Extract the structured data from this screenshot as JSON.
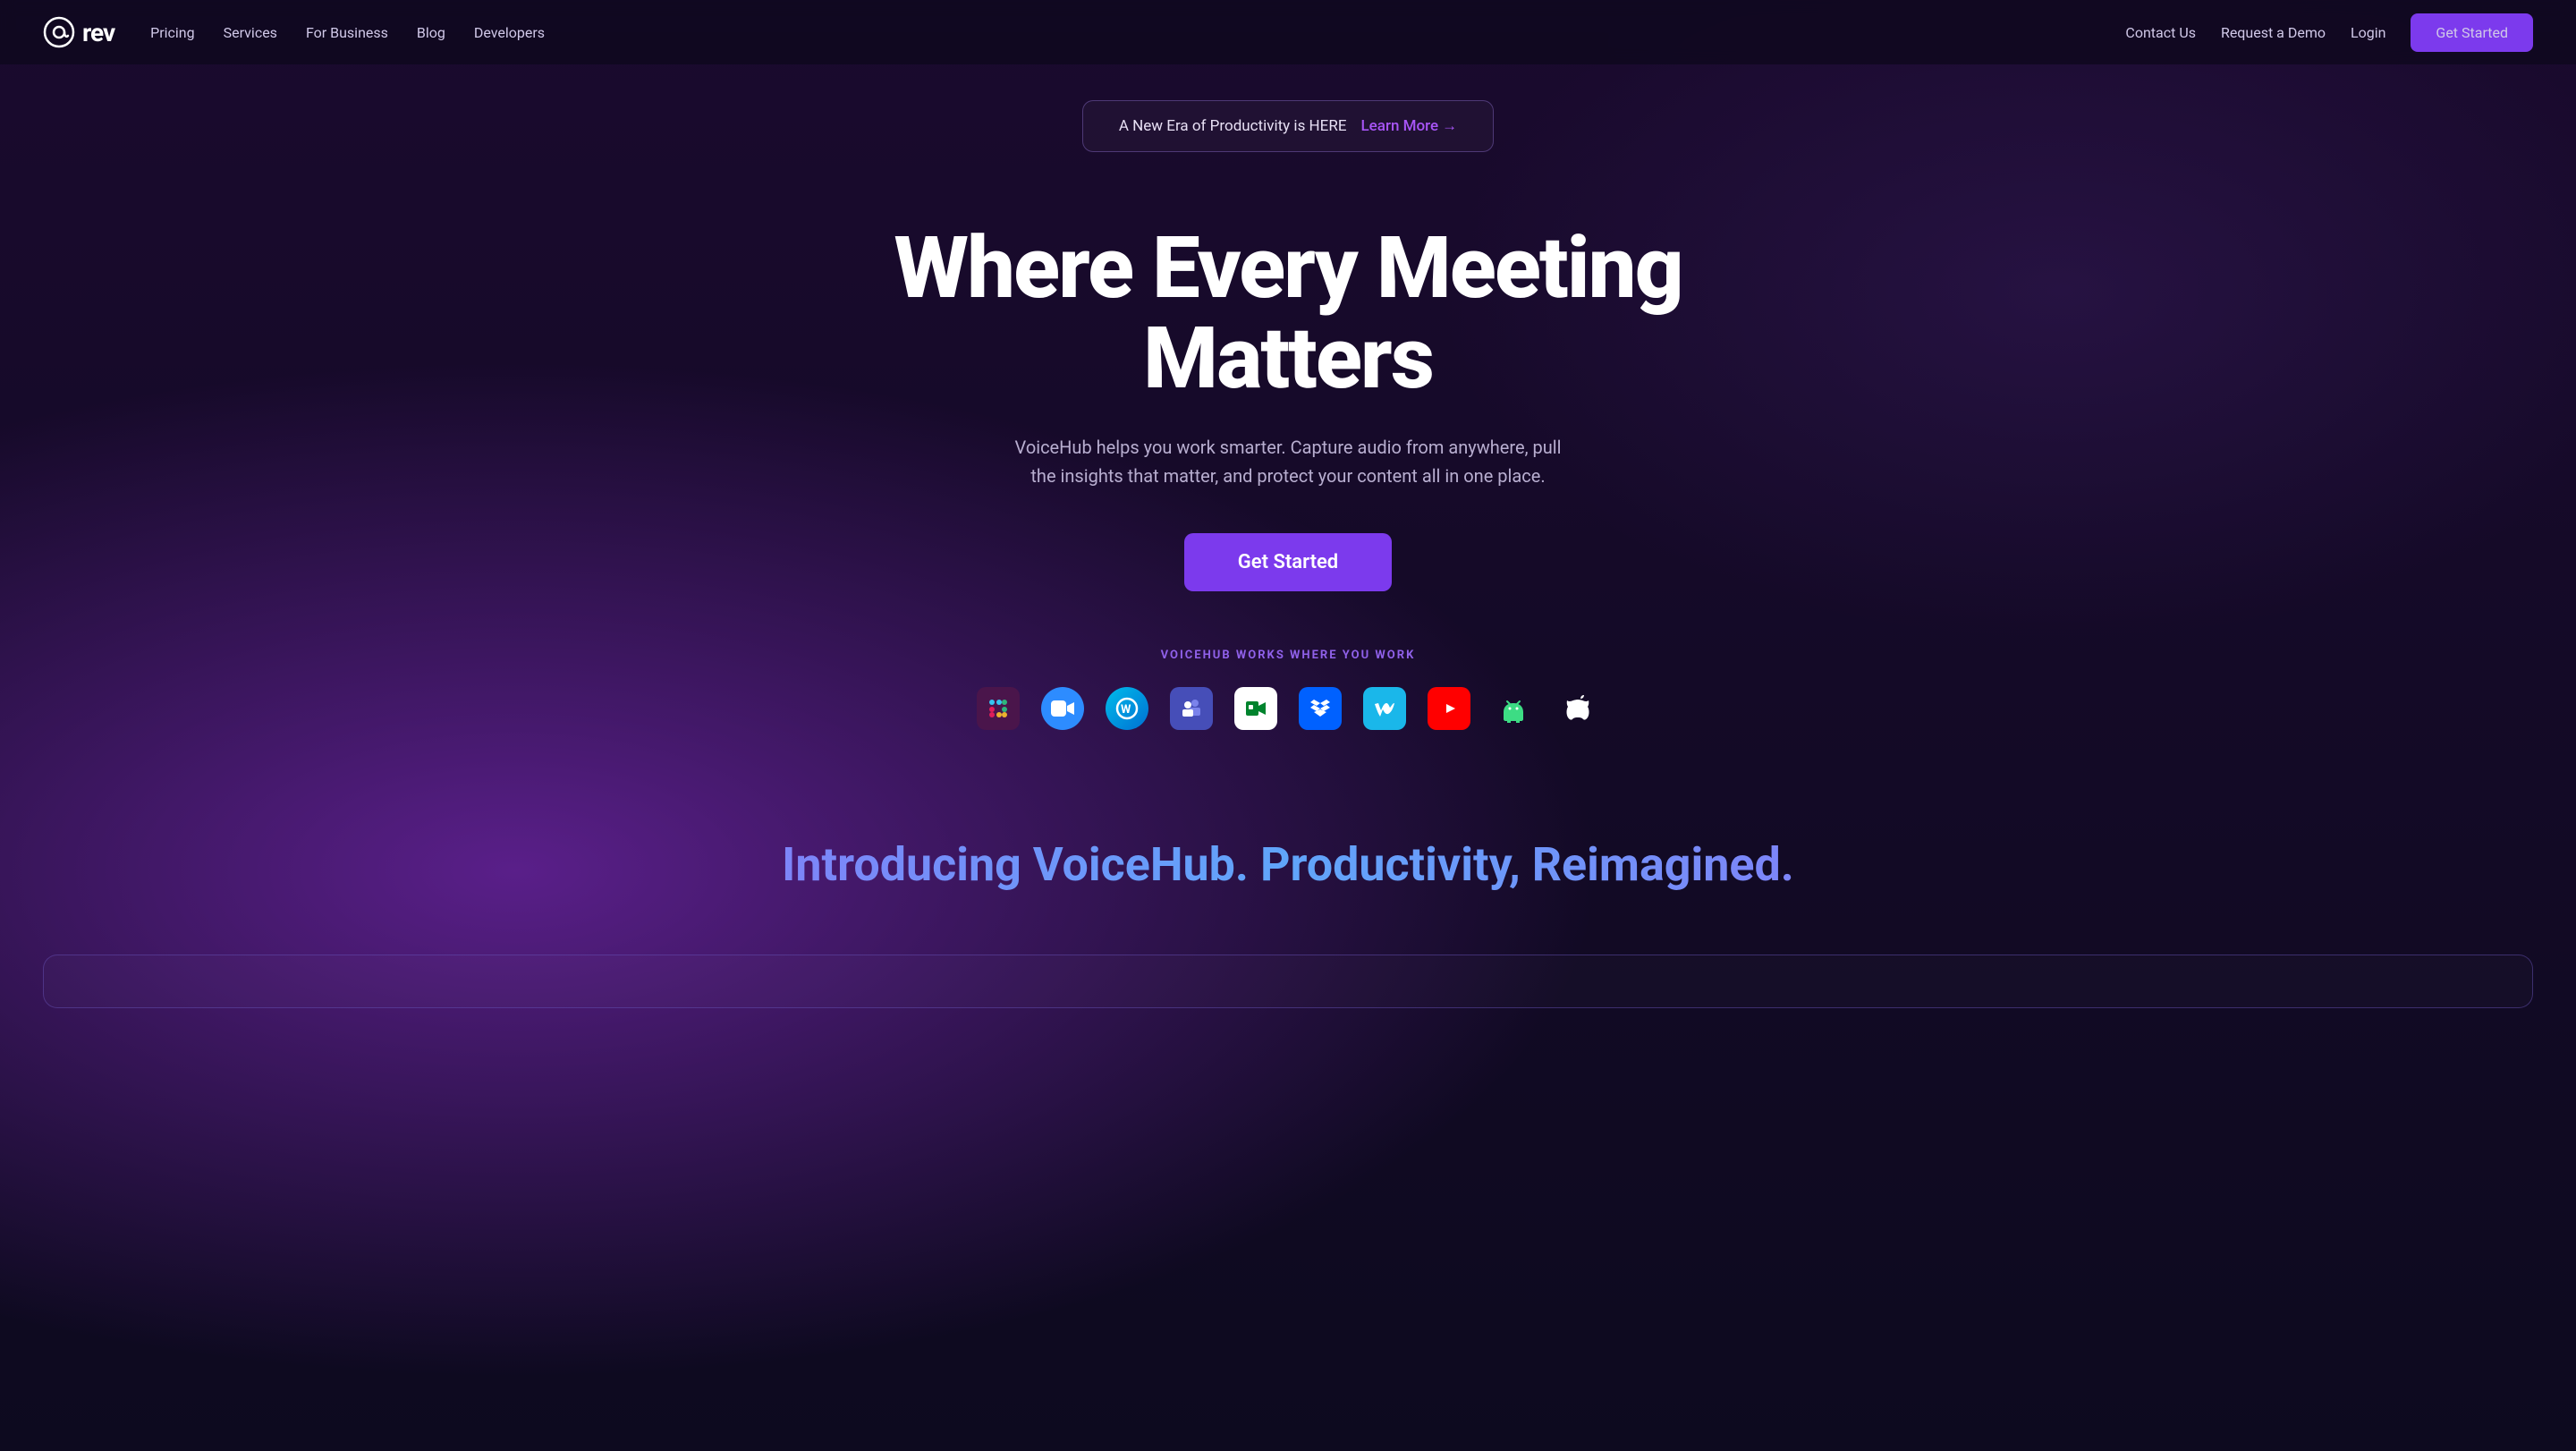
{
  "nav": {
    "logo_text": "rev",
    "links": [
      {
        "label": "Pricing",
        "id": "pricing"
      },
      {
        "label": "Services",
        "id": "services"
      },
      {
        "label": "For Business",
        "id": "for-business"
      },
      {
        "label": "Blog",
        "id": "blog"
      },
      {
        "label": "Developers",
        "id": "developers"
      }
    ],
    "right_links": [
      {
        "label": "Contact Us",
        "id": "contact-us"
      },
      {
        "label": "Request a Demo",
        "id": "request-demo"
      },
      {
        "label": "Login",
        "id": "login"
      }
    ],
    "cta_label": "Get Started"
  },
  "announcement": {
    "text": "A New Era of Productivity is HERE",
    "learn_more_label": "Learn More",
    "arrow": "→"
  },
  "hero": {
    "title": "Where Every Meeting Matters",
    "subtitle": "VoiceHub helps you work smarter. Capture audio from anywhere, pull the insights that matter, and protect your content all in one place.",
    "cta_label": "Get Started"
  },
  "integrations": {
    "label": "VOICEHUB WORKS WHERE YOU WORK",
    "icons": [
      {
        "id": "slack",
        "name": "Slack"
      },
      {
        "id": "zoom",
        "name": "Zoom"
      },
      {
        "id": "webex",
        "name": "Webex"
      },
      {
        "id": "teams",
        "name": "Microsoft Teams"
      },
      {
        "id": "meet",
        "name": "Google Meet"
      },
      {
        "id": "dropbox",
        "name": "Dropbox"
      },
      {
        "id": "vimeo",
        "name": "Vimeo"
      },
      {
        "id": "youtube",
        "name": "YouTube"
      },
      {
        "id": "android",
        "name": "Android"
      },
      {
        "id": "apple",
        "name": "Apple"
      }
    ]
  },
  "introducing": {
    "title": "Introducing VoiceHub. Productivity, Reimagined."
  }
}
